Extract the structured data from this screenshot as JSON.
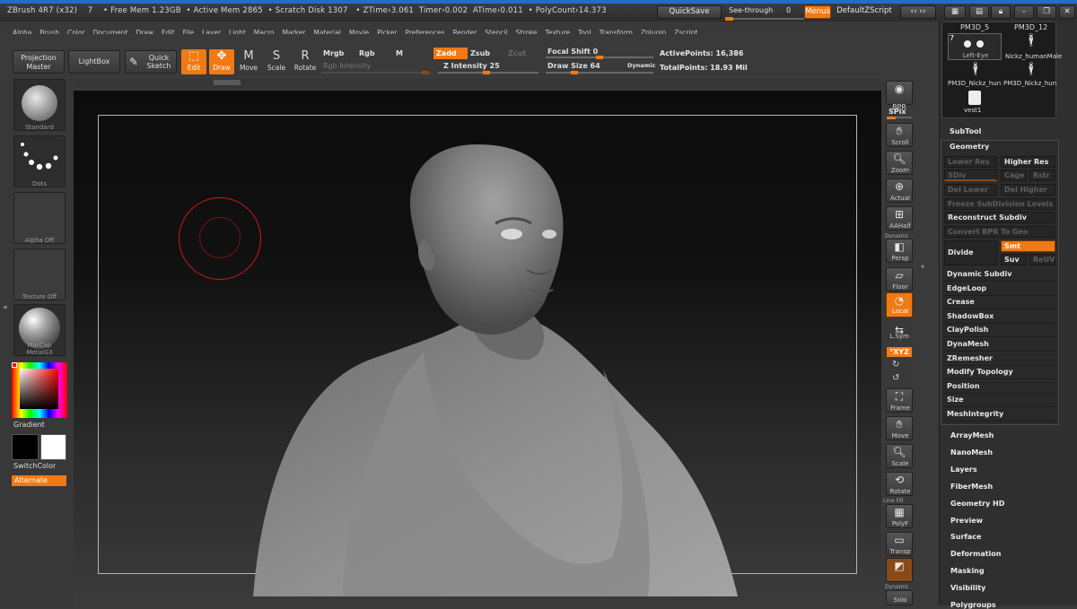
{
  "titlebar": {
    "app": "ZBrush 4R7 (x32)",
    "num": "7",
    "free_mem": "• Free Mem 1.23GB",
    "active_mem": "• Active Mem 2865",
    "scratch": "• Scratch Disk 1307",
    "ztime": "• ZTime›3.061",
    "timer": "Timer›0.002",
    "atime": "ATime›0.011",
    "polycount": "• PolyCount›14.373",
    "quicksave": "QuickSave",
    "seethrough": "See-through",
    "seethrough_val": "0",
    "menus": "Menus",
    "defaultzscript": "DefaultZScript"
  },
  "menubar": [
    "Alpha",
    "Brush",
    "Color",
    "Document",
    "Draw",
    "Edit",
    "File",
    "Layer",
    "Light",
    "Macro",
    "Marker",
    "Material",
    "Movie",
    "Picker",
    "Preferences",
    "Render",
    "Stencil",
    "Stroke",
    "Texture",
    "Tool",
    "Transform",
    "Zplugin",
    "Zscript"
  ],
  "toolbar": {
    "projection_master": "Projection Master",
    "lightbox": "LightBox",
    "quick_sketch": "Quick Sketch",
    "edit": "Edit",
    "draw": "Draw",
    "move": "Move",
    "scale": "Scale",
    "rotate": "Rotate",
    "mrgb": "Mrgb",
    "rgb": "Rgb",
    "m": "M",
    "zadd": "Zadd",
    "zsub": "Zsub",
    "zcut": "Zcut",
    "rgb_intensity": "Rgb Intensity",
    "z_intensity": "Z Intensity 25",
    "focal_shift": "Focal Shift 0",
    "draw_size": "Draw Size 64",
    "dynamic": "Dynamic",
    "active_points": "ActivePoints: 16,386",
    "total_points": "TotalPoints: 18.93 Mil"
  },
  "leftshelf": {
    "standard": "Standard",
    "dots": "Dots",
    "alpha_off": "Alpha Off",
    "texture_off": "Texture Off",
    "matcap": "MatCap MetalG3",
    "gradient": "Gradient",
    "switchcolor": "SwitchColor",
    "alternate": "Alternate"
  },
  "rightshelf": {
    "bpr": "BPR",
    "spix": "SPix",
    "scroll": "Scroll",
    "zoom": "Zoom",
    "actual": "Actual",
    "aahalf": "AAHalf",
    "dynamic": "Dynamic",
    "persp": "Persp",
    "floor": "Floor",
    "local": "Local",
    "lsym": "L.Sym",
    "xyz": "°XYZ",
    "frame": "Frame",
    "move": "Move",
    "scale": "Scale",
    "rotate": "Rotate",
    "line_fill": "Line Fill",
    "polyf": "PolyF",
    "transp": "Transp",
    "dynamic2": "Dynamic",
    "solo": "Solo"
  },
  "palette": {
    "tools": [
      {
        "label": "PM3D_5"
      },
      {
        "label": "PM3D_12"
      },
      {
        "label": "Left-Eye",
        "badge": "7"
      },
      {
        "label": "Nickz_humanMale"
      },
      {
        "label": "PM3D_Nickz_hun"
      },
      {
        "label": "PM3D_Nickz_hun"
      },
      {
        "label": "vest1"
      }
    ],
    "subtool": "SubTool",
    "geometry": "Geometry",
    "lower_res": "Lower Res",
    "higher_res": "Higher Res",
    "sdiv": "SDiv",
    "cage": "Cage",
    "rstr": "Rstr",
    "del_lower": "Del Lower",
    "del_higher": "Del Higher",
    "freeze": "Freeze SubDivision Levels",
    "reconstruct": "Reconstruct Subdiv",
    "convert_bpr": "Convert BPR To Geo",
    "divide": "Divide",
    "smt": "Smt",
    "suv": "Suv",
    "reuv": "ReUV",
    "geo_items": [
      "Dynamic Subdiv",
      "EdgeLoop",
      "Crease",
      "ShadowBox",
      "ClayPolish",
      "DynaMesh",
      "ZRemesher",
      "Modify Topology",
      "Position",
      "Size",
      "MeshIntegrity"
    ],
    "sections": [
      "ArrayMesh",
      "NanoMesh",
      "Layers",
      "FiberMesh",
      "Geometry HD",
      "Preview",
      "Surface",
      "Deformation",
      "Masking",
      "Visibility",
      "Polygroups"
    ]
  }
}
